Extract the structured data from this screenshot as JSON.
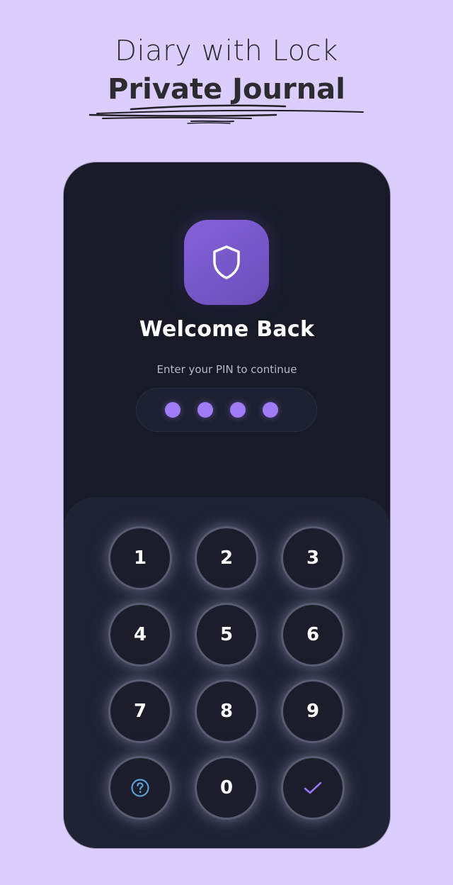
{
  "headline": {
    "line1": "Diary with Lock",
    "line2": "Private Journal"
  },
  "lock_screen": {
    "app_icon": "shield-icon",
    "title": "Welcome Back",
    "subtitle": "Enter your PIN to continue",
    "pin": {
      "length": 4,
      "filled": 4,
      "dot_color": "#a07cf7"
    },
    "keypad": {
      "keys": [
        {
          "label": "1",
          "type": "digit"
        },
        {
          "label": "2",
          "type": "digit"
        },
        {
          "label": "3",
          "type": "digit"
        },
        {
          "label": "4",
          "type": "digit"
        },
        {
          "label": "5",
          "type": "digit"
        },
        {
          "label": "6",
          "type": "digit"
        },
        {
          "label": "7",
          "type": "digit"
        },
        {
          "label": "8",
          "type": "digit"
        },
        {
          "label": "9",
          "type": "digit"
        },
        {
          "label": "",
          "type": "help",
          "icon": "help-circle-icon",
          "color": "#5b9fd8"
        },
        {
          "label": "0",
          "type": "digit"
        },
        {
          "label": "",
          "type": "confirm",
          "icon": "checkmark-icon",
          "color": "#9a72ef"
        }
      ]
    }
  },
  "colors": {
    "background": "#dbcefd",
    "phone": "#181b27",
    "keypad": "#202333",
    "accent": "#7a5ccc"
  }
}
